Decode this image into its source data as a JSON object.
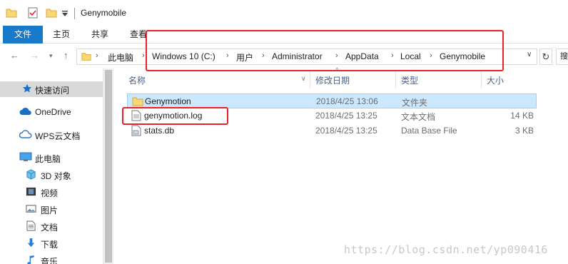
{
  "window": {
    "title": "Genymobile"
  },
  "ribbon": {
    "tabs": [
      "文件",
      "主页",
      "共享",
      "查看"
    ]
  },
  "address": {
    "crumbs": [
      "此电脑",
      "Windows 10 (C:)",
      "用户",
      "Administrator",
      "AppData",
      "Local",
      "Genymobile"
    ]
  },
  "nav": {
    "items": [
      {
        "label": "快速访问",
        "icon": "star-icon"
      },
      {
        "label": "OneDrive",
        "icon": "cloud-icon"
      },
      {
        "label": "WPS云文档",
        "icon": "wps-cloud-icon"
      },
      {
        "label": "此电脑",
        "icon": "computer-icon"
      },
      {
        "label": "3D 对象",
        "icon": "cube-icon"
      },
      {
        "label": "视频",
        "icon": "video-icon"
      },
      {
        "label": "图片",
        "icon": "picture-icon"
      },
      {
        "label": "文档",
        "icon": "document-icon"
      },
      {
        "label": "下载",
        "icon": "download-icon"
      },
      {
        "label": "音乐",
        "icon": "music-icon"
      }
    ]
  },
  "columns": {
    "name": "名称",
    "date": "修改日期",
    "type": "类型",
    "size": "大小"
  },
  "files": [
    {
      "name": "Genymotion",
      "date": "2018/4/25 13:06",
      "type": "文件夹",
      "size": "",
      "icon": "folder-icon",
      "selected": true
    },
    {
      "name": "genymotion.log",
      "date": "2018/4/25 13:25",
      "type": "文本文档",
      "size": "14 KB",
      "icon": "text-file-icon",
      "selected": false
    },
    {
      "name": "stats.db",
      "date": "2018/4/25 13:25",
      "type": "Data Base File",
      "size": "3 KB",
      "icon": "db-file-icon",
      "selected": false
    }
  ],
  "watermark": "https://blog.csdn.net/yp090416",
  "colors": {
    "accent": "#1979ca",
    "selection": "#cce8ff",
    "annotation": "#e8222a",
    "folder": "#f8d775"
  }
}
